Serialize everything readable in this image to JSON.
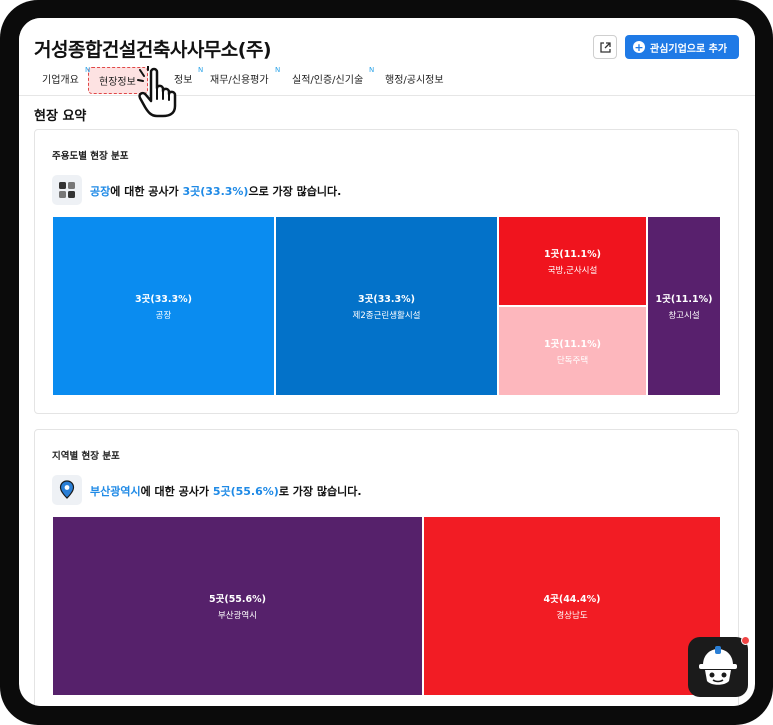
{
  "company": {
    "title": "거성종합건설건축사사무소(주)"
  },
  "actions": {
    "follow_label": "관심기업으로 추가",
    "plus_glyph": "+"
  },
  "tabs": [
    {
      "label": "기업개요",
      "new": "N"
    },
    {
      "label": "현장정보",
      "active": true
    },
    {
      "label": "정보",
      "new": "N"
    },
    {
      "label": "재무/신용평가",
      "new": "N"
    },
    {
      "label": "실적/인증/신기술",
      "new": "N"
    },
    {
      "label": "행정/공시정보"
    }
  ],
  "section": {
    "title": "현장 요약"
  },
  "usage_card": {
    "title": "주용도별 현장 분포",
    "summary": {
      "highlight": "공장",
      "mid": "에 대한 공사가 ",
      "value": "3곳(33.3%)",
      "tail": "으로 가장 많습니다."
    },
    "tiles": [
      {
        "count": "3곳(33.3%)",
        "name": "공장",
        "color": "#0a8cf0"
      },
      {
        "count": "3곳(33.3%)",
        "name": "제2종근린생활시설",
        "color": "#0372c9"
      },
      {
        "count": "1곳(11.1%)",
        "name": "국방,군사시설",
        "color": "#f0141e"
      },
      {
        "count": "1곳(11.1%)",
        "name": "단독주택",
        "color": "#fdb7bd"
      },
      {
        "count": "1곳(11.1%)",
        "name": "창고시설",
        "color": "#58206d"
      }
    ]
  },
  "region_card": {
    "title": "지역별 현장 분포",
    "summary": {
      "highlight": "부산광역시",
      "mid": "에 대한 공사가 ",
      "value": "5곳(55.6%)",
      "tail": "로 가장 많습니다."
    },
    "tiles": [
      {
        "count": "5곳(55.6%)",
        "name": "부산광역시",
        "color": "#56216b"
      },
      {
        "count": "4곳(44.4%)",
        "name": "경상남도",
        "color": "#f21c24"
      }
    ]
  },
  "chart_data": [
    {
      "type": "treemap",
      "title": "주용도별 현장 분포",
      "categories": [
        "공장",
        "제2종근린생활시설",
        "국방,군사시설",
        "단독주택",
        "창고시설"
      ],
      "values": [
        3,
        3,
        1,
        1,
        1
      ],
      "percent": [
        33.3,
        33.3,
        11.1,
        11.1,
        11.1
      ]
    },
    {
      "type": "treemap",
      "title": "지역별 현장 분포",
      "categories": [
        "부산광역시",
        "경상남도"
      ],
      "values": [
        5,
        4
      ],
      "percent": [
        55.6,
        44.4
      ]
    }
  ]
}
